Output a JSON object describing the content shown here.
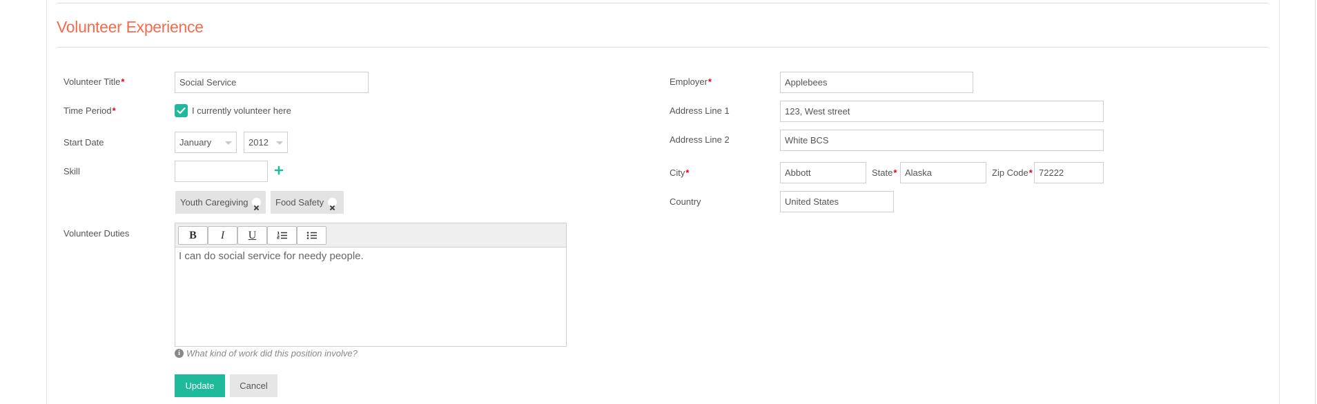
{
  "section": {
    "title": "Volunteer Experience"
  },
  "left": {
    "volunteer_title": {
      "label": "Volunteer Title",
      "required": "*",
      "value": "Social Service"
    },
    "time_period": {
      "label": "Time Period",
      "required": "*",
      "checkbox_checked": true,
      "checkbox_label": "I currently volunteer here"
    },
    "start_date": {
      "label": "Start Date",
      "month": "January",
      "year": "2012"
    },
    "skill": {
      "label": "Skill",
      "value": "",
      "tags": [
        "Youth Caregiving",
        "Food Safety"
      ]
    },
    "duties": {
      "label": "Volunteer Duties",
      "toolbar": {
        "bold": "B",
        "italic": "I",
        "underline": "U"
      },
      "content": "I can do social service for needy people.",
      "help": "What kind of work did this position involve?"
    }
  },
  "right": {
    "employer": {
      "label": "Employer",
      "required": "*",
      "value": "Applebees"
    },
    "address1": {
      "label": "Address Line 1",
      "value": "123, West street"
    },
    "address2": {
      "label": "Address Line 2",
      "value": "White BCS"
    },
    "city": {
      "label": "City",
      "required": "*",
      "value": "Abbott"
    },
    "state": {
      "label": "State",
      "required": "*",
      "value": "Alaska"
    },
    "zip": {
      "label": "Zip Code",
      "required": "*",
      "value": "72222"
    },
    "country": {
      "label": "Country",
      "value": "United States"
    }
  },
  "actions": {
    "update": "Update",
    "cancel": "Cancel"
  },
  "colors": {
    "accent": "#1fb99b",
    "title": "#f26c4f",
    "required": "#e2001a"
  }
}
